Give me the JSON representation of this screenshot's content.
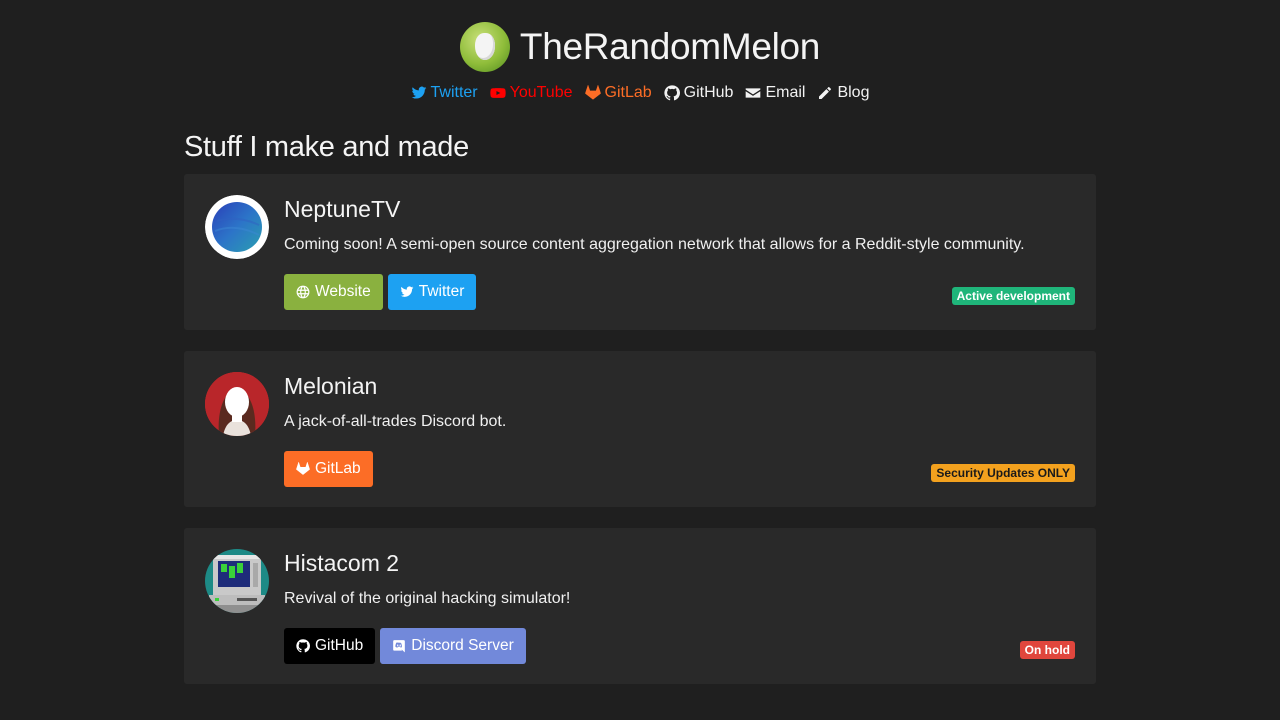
{
  "header": {
    "title": "TheRandomMelon",
    "logo_icon": "melon-logo-icon"
  },
  "nav": [
    {
      "label": "Twitter",
      "icon": "twitter-icon",
      "color": "#1da1f2"
    },
    {
      "label": "YouTube",
      "icon": "youtube-icon",
      "color": "#ff0000"
    },
    {
      "label": "GitLab",
      "icon": "gitlab-icon",
      "color": "#fc6d26"
    },
    {
      "label": "GitHub",
      "icon": "github-icon",
      "color": "#f2f2f2"
    },
    {
      "label": "Email",
      "icon": "envelope-icon",
      "color": "#f2f2f2"
    },
    {
      "label": "Blog",
      "icon": "pencil-icon",
      "color": "#f2f2f2"
    }
  ],
  "section_title": "Stuff I make and made",
  "projects": [
    {
      "name": "NeptuneTV",
      "description": "Coming soon! A semi-open source content aggregation network that allows for a Reddit-style community.",
      "buttons": [
        {
          "label": "Website",
          "icon": "globe-icon",
          "color": "#8ab13f"
        },
        {
          "label": "Twitter",
          "icon": "twitter-icon",
          "color": "#1da1f2"
        }
      ],
      "status": {
        "label": "Active development",
        "color": "#1fb57a",
        "text_color": "#ffffff"
      }
    },
    {
      "name": "Melonian",
      "description": "A jack-of-all-trades Discord bot.",
      "buttons": [
        {
          "label": "GitLab",
          "icon": "gitlab-icon",
          "color": "#fc6d26"
        }
      ],
      "status": {
        "label": "Security Updates ONLY",
        "color": "#f3a11e",
        "text_color": "#1a1a1a"
      }
    },
    {
      "name": "Histacom 2",
      "description": "Revival of the original hacking simulator!",
      "buttons": [
        {
          "label": "GitHub",
          "icon": "github-icon",
          "color": "#000000"
        },
        {
          "label": "Discord Server",
          "icon": "discord-icon",
          "color": "#7289da"
        }
      ],
      "status": {
        "label": "On hold",
        "color": "#e0463d",
        "text_color": "#ffffff"
      }
    }
  ]
}
